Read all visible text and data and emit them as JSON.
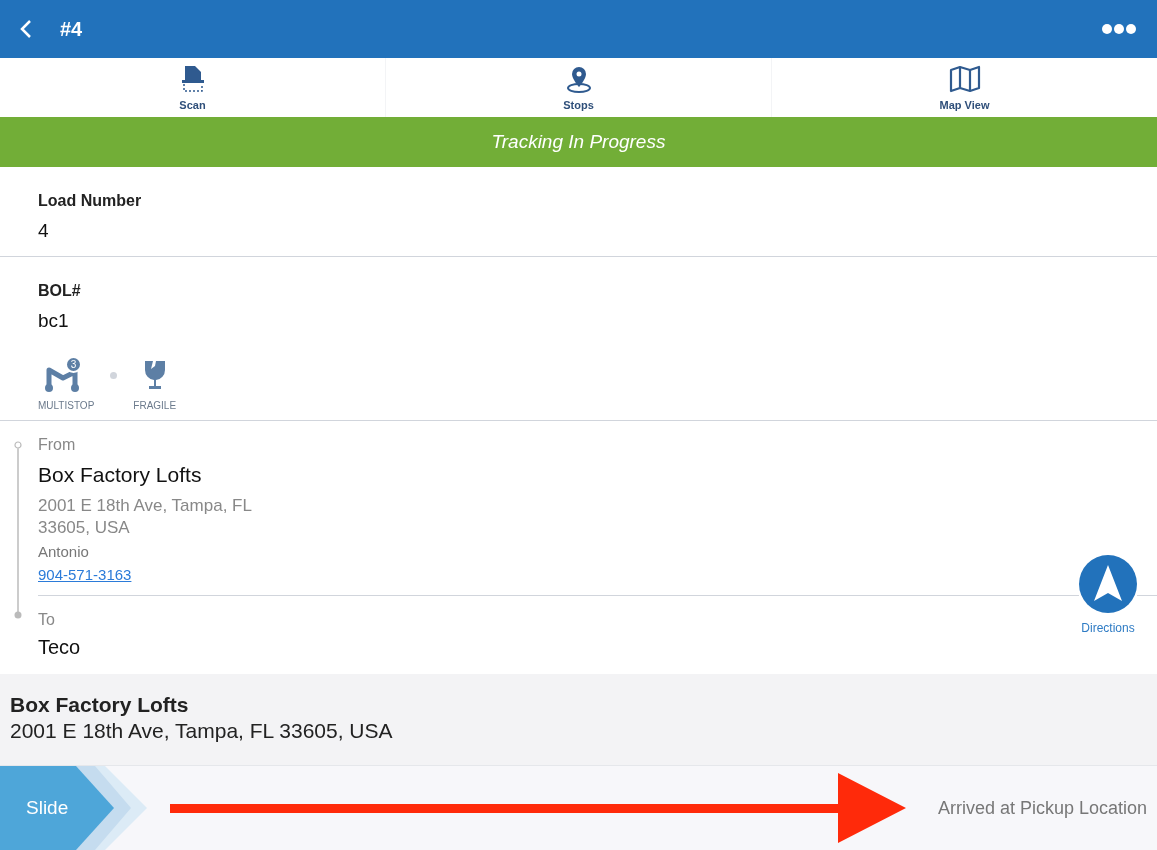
{
  "header": {
    "title": "#4"
  },
  "tabs": [
    {
      "label": "Scan",
      "kind": "scan"
    },
    {
      "label": "Stops",
      "kind": "stops"
    },
    {
      "label": "Map View",
      "kind": "map"
    }
  ],
  "status_banner": "Tracking In Progress",
  "fields": [
    {
      "label": "Load Number",
      "value": "4"
    },
    {
      "label": "BOL#",
      "value": "bc1"
    }
  ],
  "tags": [
    {
      "label": "MULTISTOP",
      "kind": "multistop",
      "badge": "3"
    },
    {
      "label": "FRAGILE",
      "kind": "fragile"
    }
  ],
  "route": {
    "from": {
      "heading": "From",
      "name": "Box Factory Lofts",
      "address": "2001 E 18th Ave, Tampa, FL\n33605, USA",
      "contact": "Antonio",
      "phone": "904-571-3163"
    },
    "to": {
      "heading": "To",
      "name": "Teco"
    },
    "directions": "Directions"
  },
  "current_location": {
    "name": "Box Factory Lofts",
    "address": "2001 E 18th Ave, Tampa, FL 33605, USA"
  },
  "slider": {
    "handle": "Slide",
    "action": "Arrived at Pickup Location"
  }
}
